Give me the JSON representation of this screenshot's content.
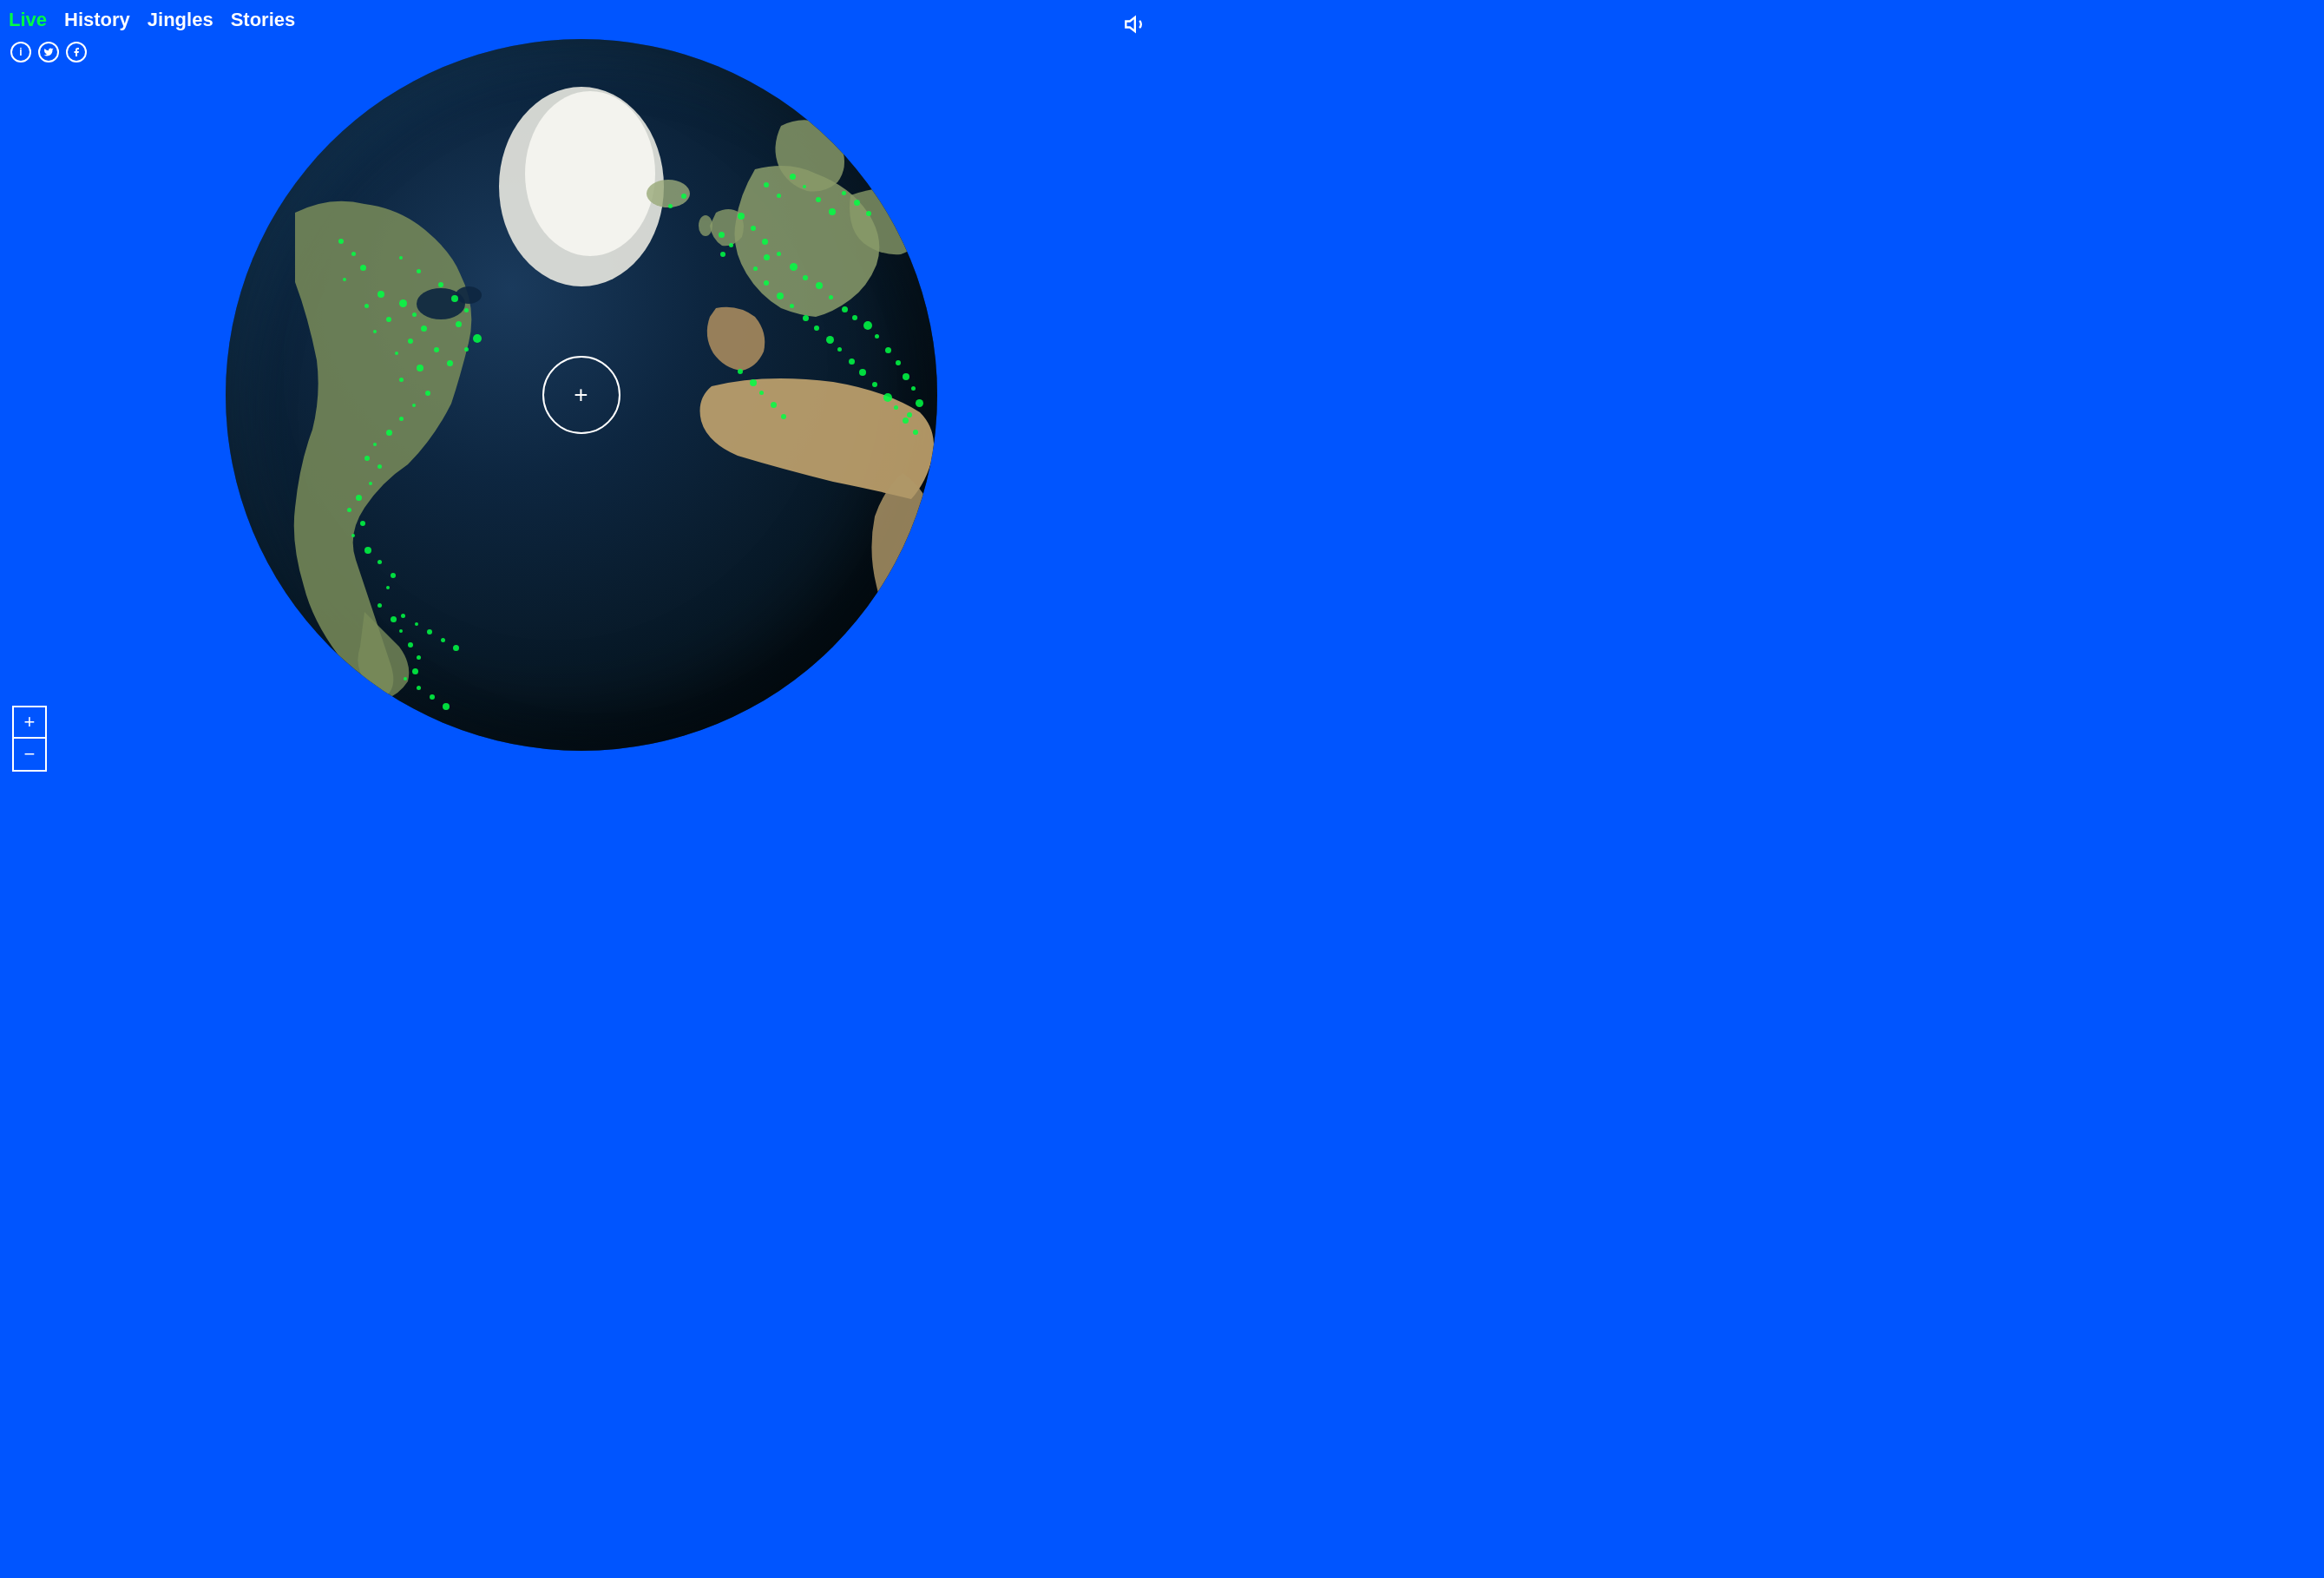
{
  "nav": {
    "items": [
      {
        "label": "Live",
        "active": true
      },
      {
        "label": "History",
        "active": false
      },
      {
        "label": "Jingles",
        "active": false
      },
      {
        "label": "Stories",
        "active": false
      }
    ]
  },
  "social": {
    "icons": [
      {
        "name": "info",
        "symbol": "i"
      },
      {
        "name": "twitter",
        "symbol": "t"
      },
      {
        "name": "facebook",
        "symbol": "f"
      }
    ]
  },
  "zoom": {
    "plus_label": "+",
    "minus_label": "−"
  },
  "crosshair": {
    "symbol": "+"
  },
  "colors": {
    "background": "#0055ff",
    "active_nav": "#00ff44",
    "dots": "#00ff44"
  }
}
